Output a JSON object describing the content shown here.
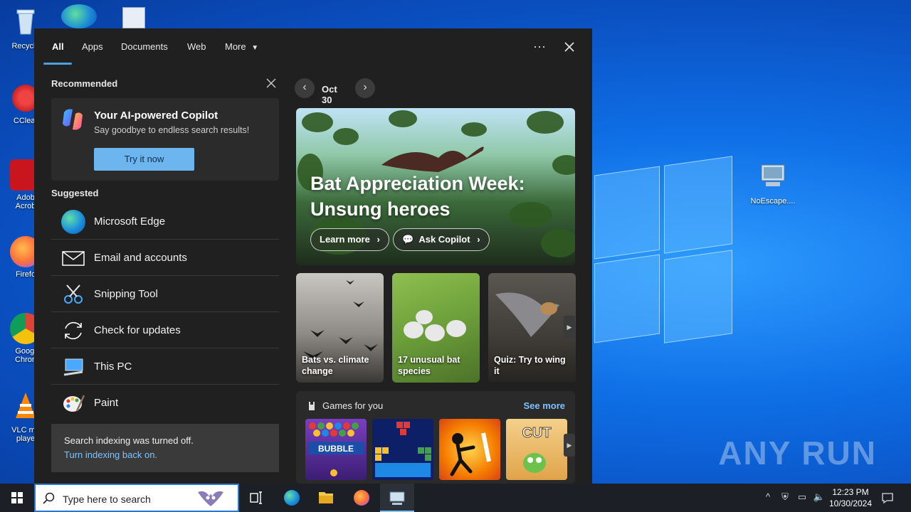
{
  "desktop": {
    "icons": [
      {
        "label": "Recycle",
        "icon": "recycle-bin-icon"
      },
      {
        "label": "CClear",
        "icon": "ccleaner-icon"
      },
      {
        "label": "Adob Acrob",
        "icon": "acrobat-icon"
      },
      {
        "label": "Firefo",
        "icon": "firefox-icon"
      },
      {
        "label": "Googl Chron",
        "icon": "chrome-icon"
      },
      {
        "label": "VLC me playe",
        "icon": "vlc-icon"
      },
      {
        "label": "NoEscape....",
        "icon": "computer-shortcut-icon"
      }
    ],
    "watermark": "ANY RUN"
  },
  "panel": {
    "tabs": [
      {
        "label": "All",
        "active": true
      },
      {
        "label": "Apps"
      },
      {
        "label": "Documents"
      },
      {
        "label": "Web"
      },
      {
        "label": "More"
      }
    ],
    "recommended": {
      "title": "Recommended",
      "card_title": "Your AI-powered Copilot",
      "card_subtitle": "Say goodbye to endless search results!",
      "button": "Try it now"
    },
    "suggested": {
      "title": "Suggested",
      "items": [
        {
          "label": "Microsoft Edge",
          "icon": "edge-icon"
        },
        {
          "label": "Email and accounts",
          "icon": "mail-icon"
        },
        {
          "label": "Snipping Tool",
          "icon": "snipping-tool-icon"
        },
        {
          "label": "Check for updates",
          "icon": "refresh-icon"
        },
        {
          "label": "This PC",
          "icon": "this-pc-icon"
        },
        {
          "label": "Paint",
          "icon": "paint-icon"
        }
      ]
    },
    "indexing": {
      "message": "Search indexing was turned off.",
      "link": "Turn indexing back on."
    },
    "highlights": {
      "date": "Oct 30",
      "hero_title": "Bat Appreciation Week: Unsung heroes",
      "learn_more": "Learn more",
      "ask_copilot": "Ask Copilot",
      "cards": [
        {
          "text": "Bats vs. climate change"
        },
        {
          "text": "17 unusual bat species"
        },
        {
          "text": "Quiz: Try to wing it"
        }
      ],
      "games_title": "Games for you",
      "see_more": "See more",
      "games": [
        "Bubble Shooter HD",
        "Block puzzle",
        "Stickman fighter",
        "Cut the Rope"
      ]
    }
  },
  "taskbar": {
    "search_placeholder": "Type here to search",
    "time": "12:23 PM",
    "date": "10/30/2024"
  }
}
